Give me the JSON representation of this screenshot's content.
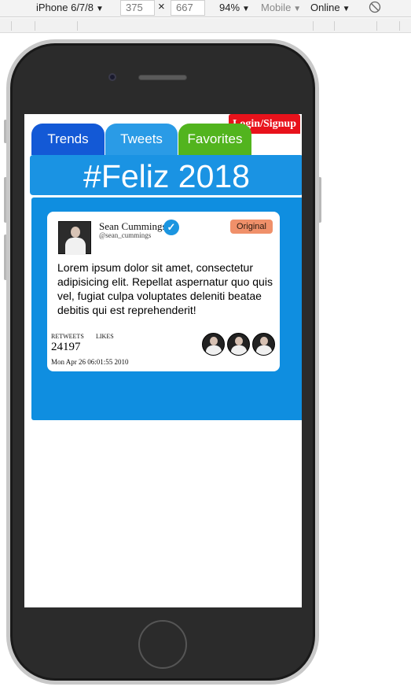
{
  "toolbar": {
    "device": "iPhone 6/7/8",
    "width": "375",
    "times": "×",
    "height": "667",
    "zoom": "94%",
    "mode": "Mobile",
    "network": "Online",
    "caret": "▼"
  },
  "app": {
    "login_label": "Login/Signup",
    "tabs": [
      {
        "label": "Trends",
        "color": "#1359d6"
      },
      {
        "label": "Tweets",
        "color": "#2a9be6"
      },
      {
        "label": "Favorites",
        "color": "#52b41e"
      }
    ],
    "hashtag": "#Feliz 2018"
  },
  "tweet": {
    "name": "Sean Cummings",
    "handle": "@sean_cummings",
    "badge": "Original",
    "text": "Lorem ipsum dolor sit amet, consectetur adipisicing elit. Repellat aspernatur quo quis vel, fugiat culpa voluptates deleniti beatae debitis qui est reprehenderit!",
    "retweets_label": "RETWEETS",
    "likes_label": "LIKES",
    "retweet_count": "24197",
    "date": "Mon Apr 26 06:01:55 2010"
  },
  "colors": {
    "panel": "#0f8ee0",
    "banner": "#1a93e3",
    "login": "#e8121b",
    "badge": "#f0906a"
  }
}
